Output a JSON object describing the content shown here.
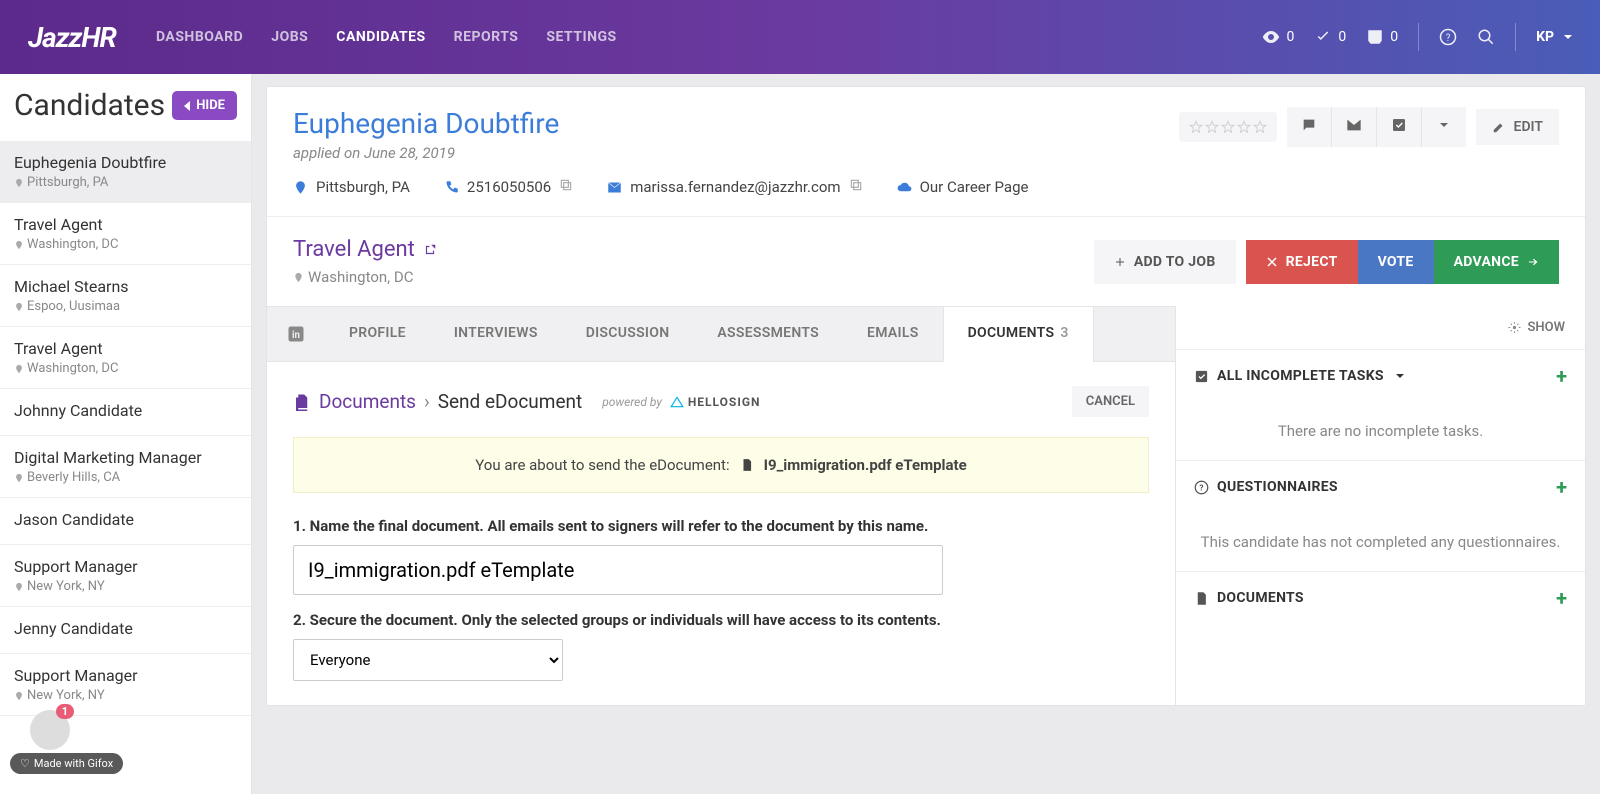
{
  "brand": "JazzHR",
  "nav": {
    "dashboard": "DASHBOARD",
    "jobs": "JOBS",
    "candidates": "CANDIDATES",
    "reports": "REPORTS",
    "settings": "SETTINGS"
  },
  "topstats": {
    "views": "0",
    "checks": "0",
    "inbox": "0"
  },
  "user": "KP",
  "sidebar": {
    "title": "Candidates",
    "hide": "HIDE",
    "items": [
      {
        "name": "Euphegenia Doubtfire",
        "loc": "Pittsburgh, PA"
      },
      {
        "name": "Travel Agent",
        "loc": "Washington, DC"
      },
      {
        "name": "Michael Stearns",
        "loc": "Espoo, Uusimaa"
      },
      {
        "name": "Travel Agent",
        "loc": "Washington, DC"
      },
      {
        "name": "Johnny Candidate",
        "loc": ""
      },
      {
        "name": "Digital Marketing Manager",
        "loc": "Beverly Hills, CA"
      },
      {
        "name": "Jason Candidate",
        "loc": ""
      },
      {
        "name": "Support Manager",
        "loc": "New York, NY"
      },
      {
        "name": "Jenny Candidate",
        "loc": ""
      },
      {
        "name": "Support Manager",
        "loc": "New York, NY"
      }
    ]
  },
  "profile": {
    "name": "Euphegenia Doubtfire",
    "applied": "applied on June 28, 2019",
    "location": "Pittsburgh, PA",
    "phone": "2516050506",
    "email": "marissa.fernandez@jazzhr.com",
    "source": "Our Career Page",
    "edit": "EDIT"
  },
  "job": {
    "title": "Travel Agent",
    "location": "Washington, DC",
    "add": "ADD TO JOB",
    "reject": "REJECT",
    "vote": "VOTE",
    "advance": "ADVANCE"
  },
  "tabs": {
    "profile": "PROFILE",
    "interviews": "INTERVIEWS",
    "discussion": "DISCUSSION",
    "assessments": "ASSESSMENTS",
    "emails": "EMAILS",
    "documents": "DOCUMENTS",
    "documents_count": "3"
  },
  "doc": {
    "breadcrumb_root": "Documents",
    "breadcrumb_current": "Send eDocument",
    "powered": "powered by",
    "provider": "HELLOSIGN",
    "cancel": "CANCEL",
    "notice_pre": "You are about to send the eDocument:",
    "notice_file": "I9_immigration.pdf eTemplate",
    "step1": "1. Name the final document. All emails sent to signers will refer to the document by this name.",
    "name_value": "I9_immigration.pdf eTemplate",
    "step2": "2. Secure the document. Only the selected groups or individuals will have access to its contents.",
    "secure_value": "Everyone"
  },
  "right": {
    "show": "SHOW",
    "tasks_title": "ALL INCOMPLETE TASKS",
    "tasks_empty": "There are no incomplete tasks.",
    "quest_title": "QUESTIONNAIRES",
    "quest_empty": "This candidate has not completed any questionnaires.",
    "docs_title": "DOCUMENTS"
  },
  "footer": {
    "made_with": "Made with Gifox",
    "badge": "1"
  }
}
